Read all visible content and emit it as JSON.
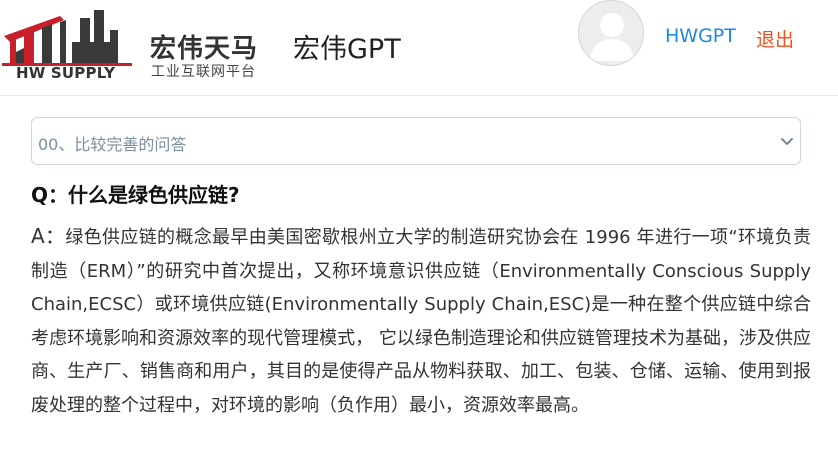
{
  "header": {
    "logo": {
      "brand_sub": "HW SUPPLY",
      "company_name": "宏伟天马",
      "company_tagline": "工业互联网平台"
    },
    "app_title": "宏伟GPT",
    "user_link": "HWGPT",
    "logout_label": "退出"
  },
  "qa_select": {
    "selected": "00、比较完善的问答"
  },
  "qa": {
    "question": "Q：什么是绿色供应链?",
    "answer_prefix": "A：",
    "answer": "绿色供应链的概念最早由美国密歇根州立大学的制造研究协会在 1996 年进行一项“环境负责制造（ERM）”的研究中首次提出，又称环境意识供应链（Environmentally Conscious Supply Chain,ECSC）或环境供应链(Environmentally Supply Chain,ESC)是一种在整个供应链中综合考虑环境影响和资源效率的现代管理模式， 它以绿色制造理论和供应链管理技术为基础，涉及供应商、生产厂、销售商和用户，其目的是使得产品从物料获取、加工、包装、仓储、运输、使用到报废处理的整个过程中，对环境的影响（负作用）最小，资源效率最高。"
  },
  "colors": {
    "logo_red": "#c8202a",
    "logo_dark": "#3a3a3a",
    "link_blue": "#1e88e5",
    "logout_orange": "#f4511e"
  }
}
